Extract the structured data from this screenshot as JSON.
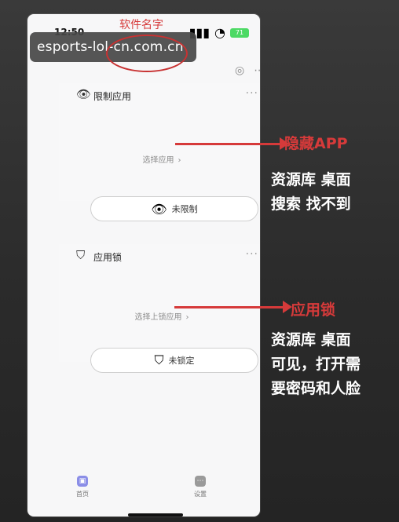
{
  "status_bar": {
    "time": "12:50",
    "battery": "71"
  },
  "watermark": "esports-lol-cn.com.cn",
  "annotations": {
    "app_name_label": "软件名字",
    "hide_label": "隐藏APP",
    "hide_desc": "资源库 桌面\n搜索 找不到",
    "lock_label": "应用锁",
    "lock_desc": "资源库 桌面\n可见，打开需\n要密码和人脸"
  },
  "sections": {
    "restrict": {
      "title": "限制应用",
      "choose": "选择应用",
      "button": "未限制"
    },
    "lock": {
      "title": "应用锁",
      "choose": "选择上锁应用",
      "button": "未锁定"
    }
  },
  "bottom_nav": {
    "home": "首页",
    "settings": "设置"
  },
  "colors": {
    "annotation_red": "#d63a3a",
    "nav_accent": "#8b8ee7"
  }
}
